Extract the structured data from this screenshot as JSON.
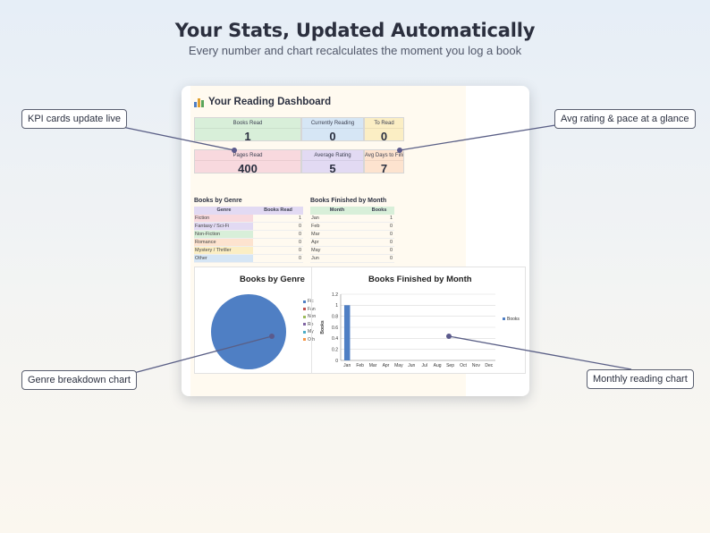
{
  "header": {
    "title": "Your Stats, Updated Automatically",
    "subtitle": "Every number and chart recalculates the moment you log a book"
  },
  "dashboard": {
    "title": "Your Reading Dashboard",
    "title_icon": "bar-chart-icon",
    "kpis_top": [
      {
        "label": "Books Read",
        "value": "1",
        "color": "#d8efd9"
      },
      {
        "label": "Currently Reading",
        "value": "0",
        "color": "#d6e6f5"
      },
      {
        "label": "To Read",
        "value": "0",
        "color": "#fbeec4"
      }
    ],
    "kpis_bottom": [
      {
        "label": "Pages Read",
        "value": "400",
        "color": "#f8d9de"
      },
      {
        "label": "Average Rating",
        "value": "5",
        "color": "#e2daf3"
      },
      {
        "label": "Avg Days to Finish",
        "value": "7",
        "color": "#fde3cf"
      }
    ],
    "genre_table": {
      "title": "Books by Genre",
      "headers": [
        "Genre",
        "Books Read"
      ],
      "header_color": "#e2daf3",
      "rows": [
        {
          "label": "Fiction",
          "value": "1",
          "color": "#f8d9de"
        },
        {
          "label": "Fantasy / Sci-Fi",
          "value": "0",
          "color": "#e2daf3"
        },
        {
          "label": "Non-Fiction",
          "value": "0",
          "color": "#d8efd9"
        },
        {
          "label": "Romance",
          "value": "0",
          "color": "#fde3cf"
        },
        {
          "label": "Mystery / Thriller",
          "value": "0",
          "color": "#fbeec4"
        },
        {
          "label": "Other",
          "value": "0",
          "color": "#d6e6f5"
        }
      ]
    },
    "month_table": {
      "title": "Books Finished by Month",
      "headers": [
        "Month",
        "Books"
      ],
      "header_color": "#d8efd9",
      "rows": [
        {
          "label": "Jan",
          "value": "1"
        },
        {
          "label": "Feb",
          "value": "0"
        },
        {
          "label": "Mar",
          "value": "0"
        },
        {
          "label": "Apr",
          "value": "0"
        },
        {
          "label": "May",
          "value": "0"
        },
        {
          "label": "Jun",
          "value": "0"
        }
      ]
    }
  },
  "chart_data": [
    {
      "type": "pie",
      "title": "Books by Genre",
      "categories": [
        "Fiction",
        "Fantasy / Sci-Fi",
        "Non-Fiction",
        "Romance",
        "Mystery / Thriller",
        "Other"
      ],
      "legend_labels": [
        "Fic",
        "Fan",
        "Non",
        "Ro",
        "My",
        "Oth"
      ],
      "values": [
        1,
        0,
        0,
        0,
        0,
        0
      ],
      "colors": [
        "#4f7fc4",
        "#c0504d",
        "#9bbb59",
        "#8064a2",
        "#4bacc6",
        "#f79646"
      ],
      "legend": "right"
    },
    {
      "type": "bar",
      "title": "Books Finished by Month",
      "categories": [
        "Jan",
        "Feb",
        "Mar",
        "Apr",
        "May",
        "Jun",
        "Jul",
        "Aug",
        "Sep",
        "Oct",
        "Nov",
        "Dec"
      ],
      "series": [
        {
          "name": "Books",
          "values": [
            1,
            0,
            0,
            0,
            0,
            0,
            0,
            0,
            0,
            0,
            0,
            0
          ]
        }
      ],
      "ylabel": "Books",
      "ylim": [
        0,
        1.2
      ],
      "yticks": [
        0,
        0.2,
        0.4,
        0.6,
        0.8,
        1,
        1.2
      ],
      "grid": true,
      "legend": "right",
      "color": "#4f7fc4"
    }
  ],
  "callouts": {
    "kpi": "KPI cards update live",
    "rating": "Avg rating & pace at a glance",
    "genre": "Genre breakdown chart",
    "monthly": "Monthly reading chart"
  }
}
